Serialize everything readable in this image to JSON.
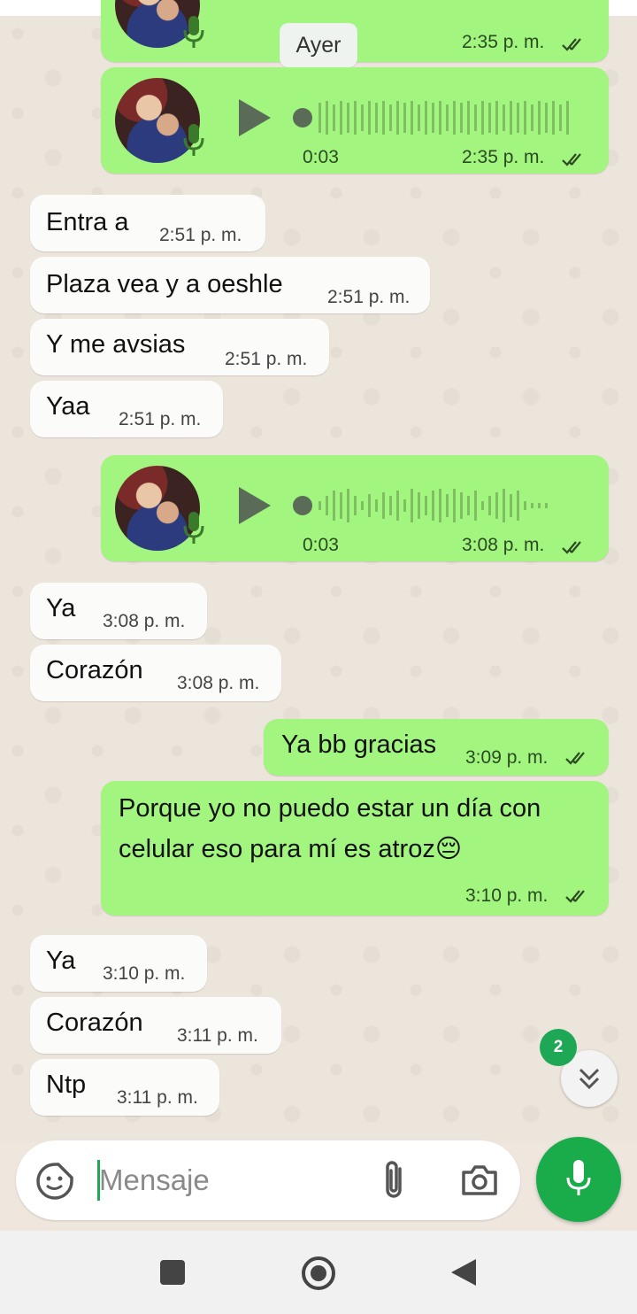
{
  "day_separator": "Ayer",
  "voice_notes": [
    {
      "duration": "",
      "time": "2:35 p. m."
    },
    {
      "duration": "0:03",
      "time": "2:35 p. m."
    },
    {
      "duration": "0:03",
      "time": "3:08 p. m."
    }
  ],
  "messages": [
    {
      "text": "Entra a",
      "time": "2:51 p. m."
    },
    {
      "text": "Plaza vea y a oeshle",
      "time": "2:51 p. m."
    },
    {
      "text": "Y me avsias",
      "time": "2:51 p. m."
    },
    {
      "text": "Yaa",
      "time": "2:51 p. m."
    },
    {
      "text": "Ya",
      "time": "3:08 p. m."
    },
    {
      "text": "Corazón",
      "time": "3:08 p. m."
    },
    {
      "text": "Ya bb gracias",
      "time": "3:09 p. m."
    },
    {
      "text_line1": "Porque yo no puedo estar un día con",
      "text_line2": "celular eso para mí es atroz😔",
      "time": "3:10 p. m."
    },
    {
      "text": "Ya",
      "time": "3:10 p. m."
    },
    {
      "text": "Corazón",
      "time": "3:11 p. m."
    },
    {
      "text": "Ntp",
      "time": "3:11 p. m."
    }
  ],
  "unread_count": "2",
  "composer": {
    "placeholder": "Mensaje"
  },
  "colors": {
    "outgoing": "#a2f57e",
    "incoming": "#fbfbfa",
    "accent": "#1aab4b"
  },
  "icons": [
    "sticker-icon",
    "attach-icon",
    "camera-icon",
    "mic-icon",
    "chevrons-down-icon",
    "play-icon",
    "double-check-icon",
    "nav-recents-icon",
    "nav-home-icon",
    "nav-back-icon"
  ]
}
